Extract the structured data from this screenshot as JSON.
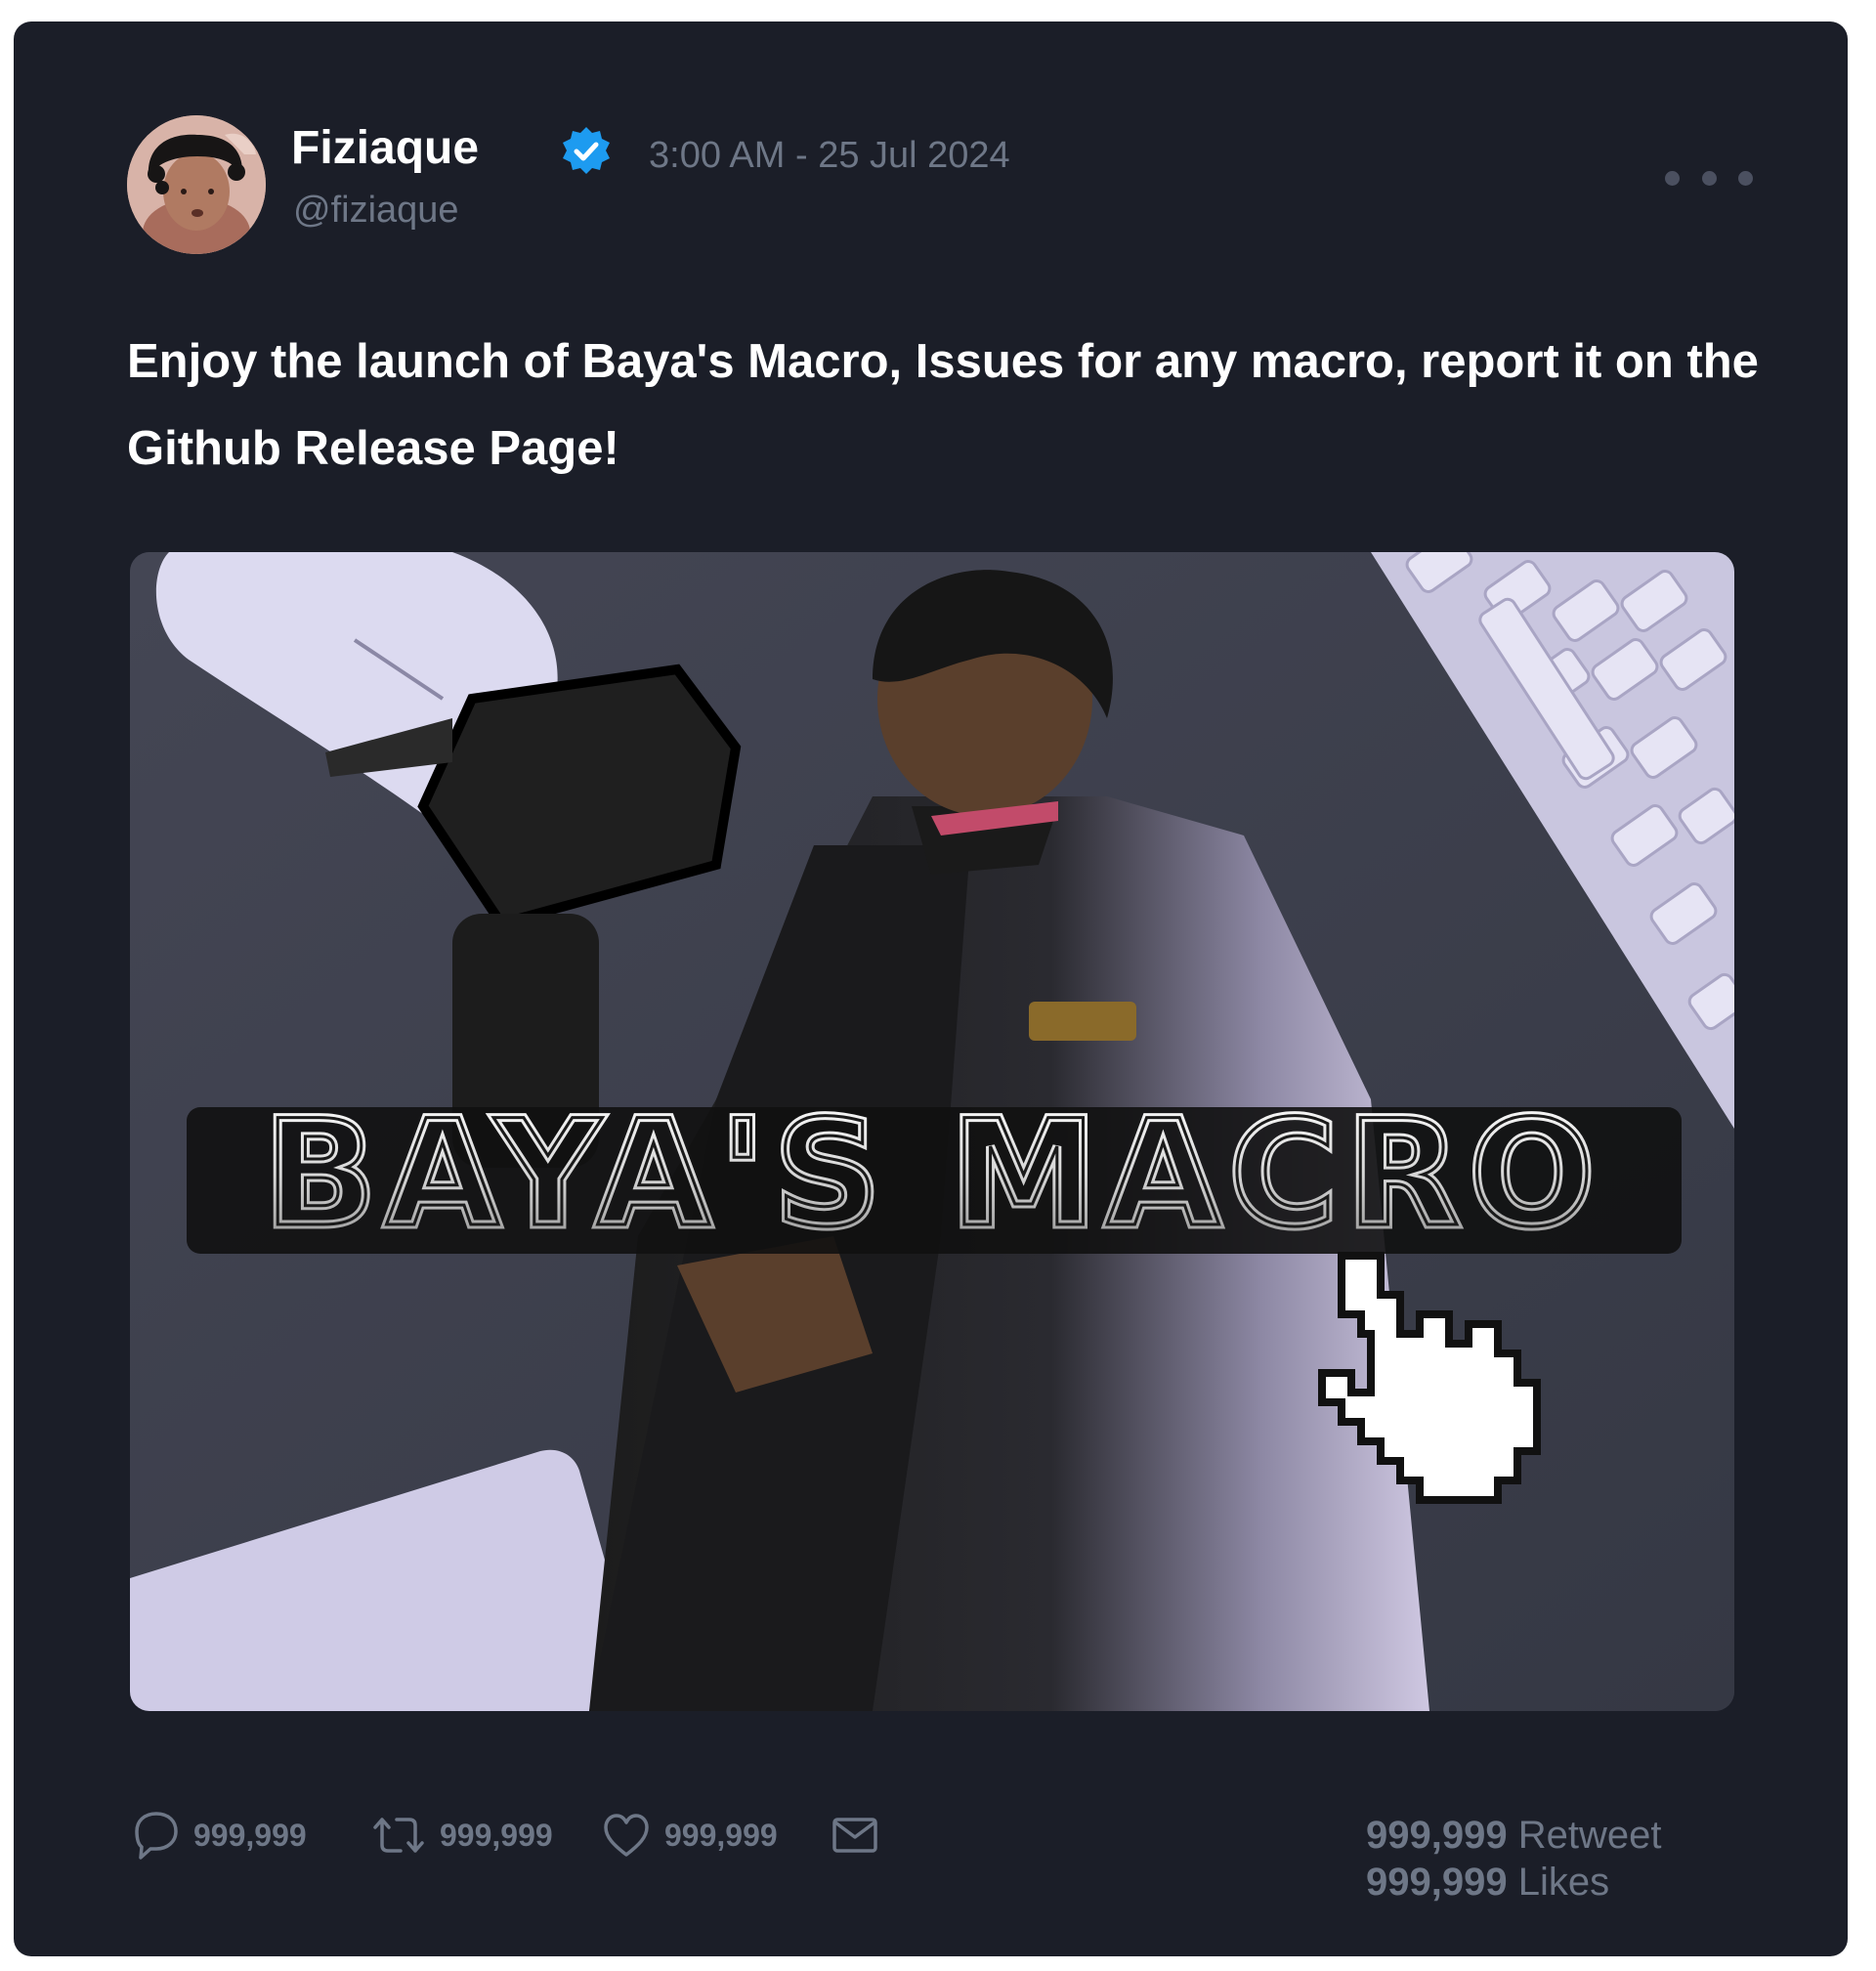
{
  "tweet": {
    "author": {
      "name": "Fiziaque",
      "handle": "@fiziaque",
      "verified": true
    },
    "timestamp": "3:00 AM - 25 Jul 2024",
    "text": "Enjoy the launch of Baya's Macro, Issues for any macro, report it on the Github Release Page!",
    "media": {
      "logo_text": "BAYA'S MACRO",
      "icons": [
        "mouse",
        "keyboard",
        "pointer-hand-cursor"
      ]
    },
    "actions": {
      "reply_count": "999,999",
      "retweet_count": "999,999",
      "like_count": "999,999"
    },
    "stats": {
      "retweet_num": "999,999",
      "retweet_label": "Retweet",
      "likes_num": "999,999",
      "likes_label": "Likes"
    }
  },
  "colors": {
    "card_background": "#1b1e28",
    "text_primary": "#ffffff",
    "text_secondary": "#6e7787",
    "verified_blue": "#1d9bf0"
  }
}
